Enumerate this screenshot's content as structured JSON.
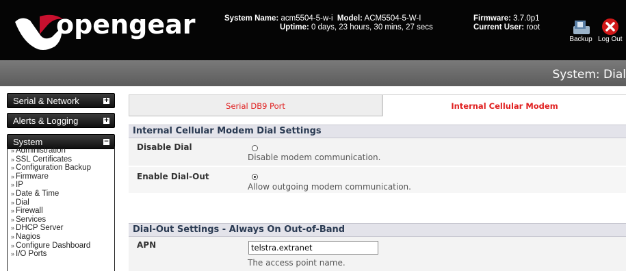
{
  "brand": {
    "name": "opengear"
  },
  "header": {
    "system_name_label": "System Name:",
    "system_name": "acm5504-5-w-i",
    "model_label": "Model:",
    "model": "ACM5504-5-W-I",
    "firmware_label": "Firmware:",
    "firmware": "3.7.0p1",
    "uptime_label": "Uptime:",
    "uptime": "0 days, 23 hours, 30 mins, 27 secs",
    "current_user_label": "Current User:",
    "current_user": "root",
    "backup_label": "Backup",
    "logout_label": "Log Out"
  },
  "page_title": "System: Dial",
  "sidebar": {
    "groups": [
      {
        "label": "Serial & Network",
        "state": "collapsed"
      },
      {
        "label": "Alerts & Logging",
        "state": "collapsed"
      },
      {
        "label": "System",
        "state": "expanded"
      }
    ],
    "system_links": [
      "Administration",
      "SSL Certificates",
      "Configuration Backup",
      "Firmware",
      "IP",
      "Date & Time",
      "Dial",
      "Firewall",
      "Services",
      "DHCP Server",
      "Nagios",
      "Configure Dashboard",
      "I/O Ports"
    ]
  },
  "tabs": [
    {
      "label": "Serial DB9 Port",
      "active": false
    },
    {
      "label": "Internal Cellular Modem",
      "active": true
    }
  ],
  "dial_settings": {
    "heading": "Internal Cellular Modem Dial Settings",
    "disable_dial": {
      "label": "Disable Dial",
      "selected": false,
      "description": "Disable modem communication."
    },
    "enable_dial_out": {
      "label": "Enable Dial-Out",
      "selected": true,
      "description": "Allow outgoing modem communication."
    }
  },
  "dialout": {
    "heading": "Dial-Out Settings - Always On Out-of-Band",
    "apn": {
      "label": "APN",
      "value": "telstra.extranet",
      "description": "The access point name."
    }
  },
  "colors": {
    "accent_red": "#e02020",
    "section_bg": "#e3e3ea",
    "header_bg": "#050505"
  }
}
